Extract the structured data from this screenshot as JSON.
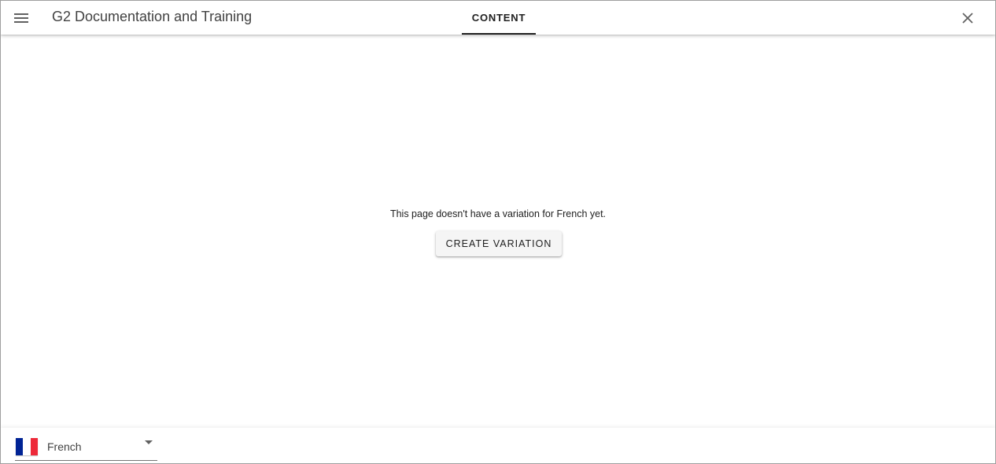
{
  "header": {
    "app_title": "G2 Documentation and Training",
    "tabs": [
      {
        "label": "CONTENT",
        "active": true
      }
    ],
    "menu_icon": "hamburger-menu-icon",
    "close_icon": "close-icon"
  },
  "main": {
    "empty_message": "This page doesn't have a variation for French yet.",
    "create_button_label": "CREATE VARIATION"
  },
  "footer": {
    "language": {
      "selected": "French",
      "flag_icon": "france-flag-icon",
      "flag_colors": [
        "#002395",
        "#ffffff",
        "#ed2939"
      ]
    }
  },
  "colors": {
    "text": "#212121",
    "button_bg": "#f5f5f5"
  }
}
